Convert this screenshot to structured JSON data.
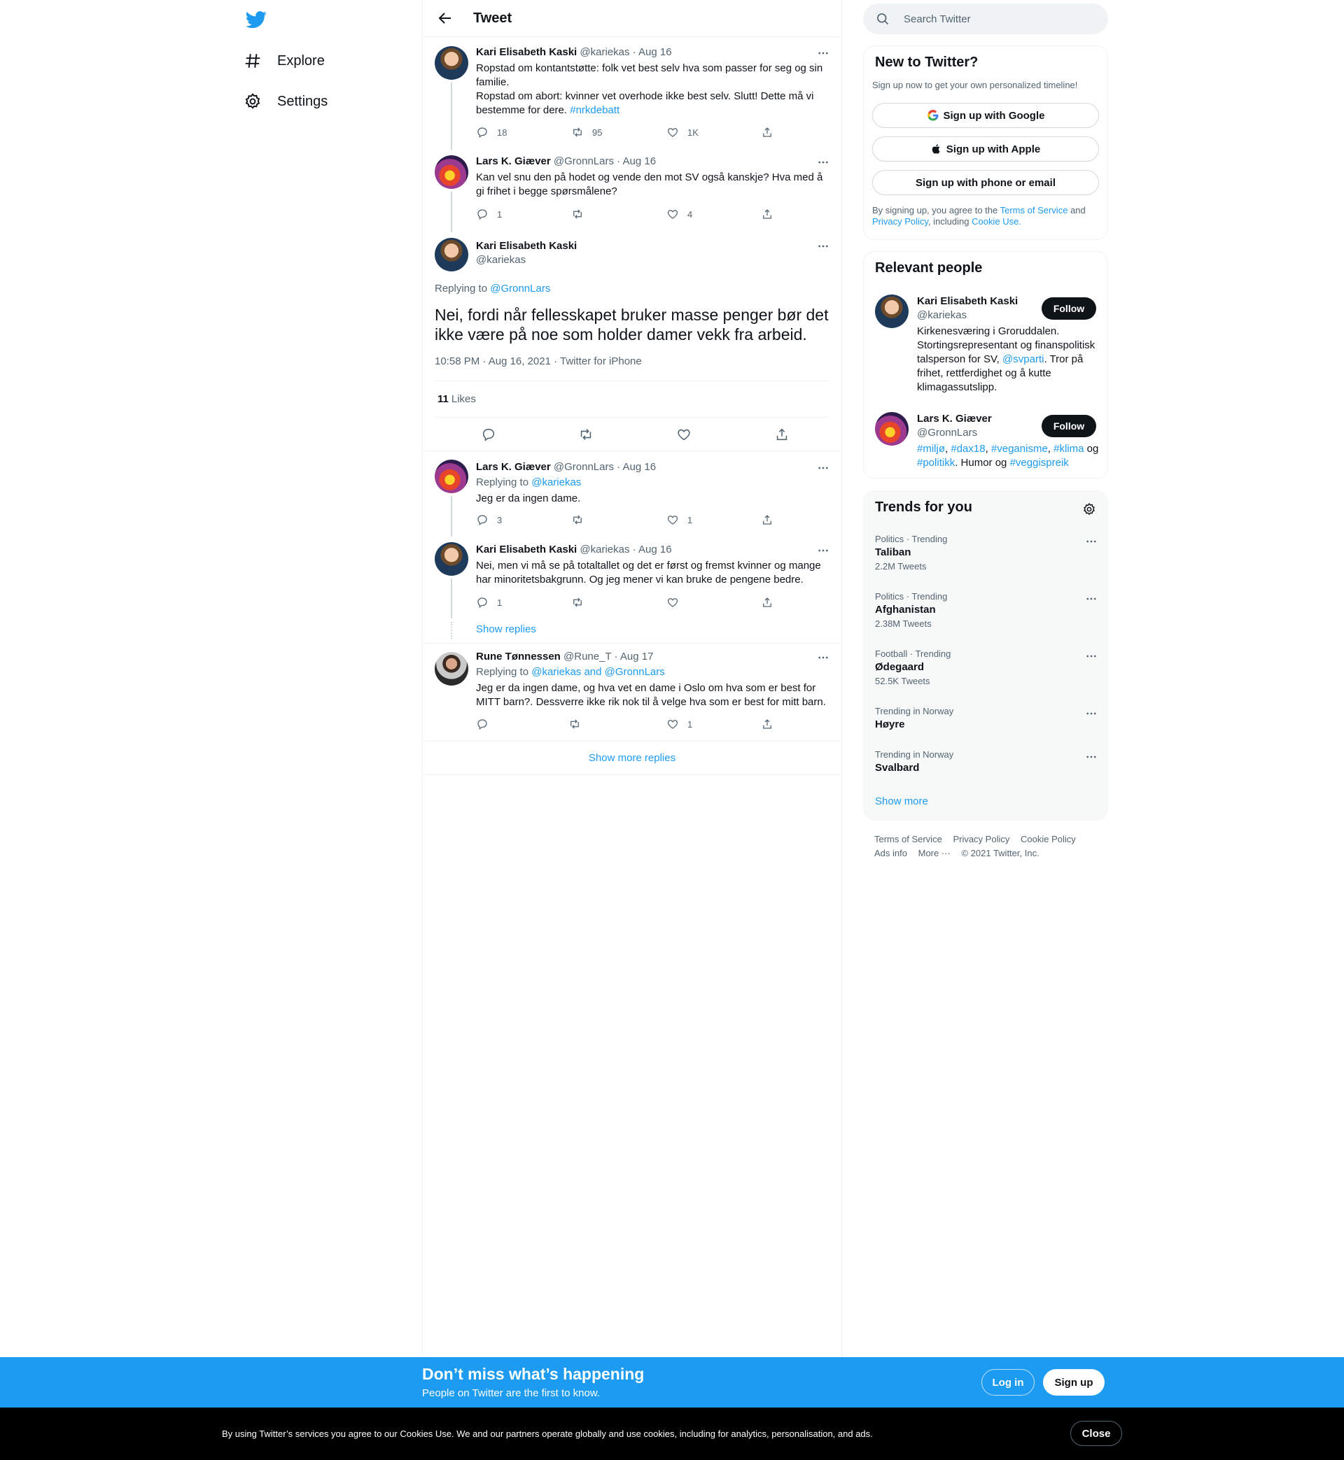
{
  "nav": {
    "explore": "Explore",
    "settings": "Settings"
  },
  "header": {
    "title": "Tweet"
  },
  "thread": [
    {
      "name": "Kari Elisabeth Kaski",
      "handle": "@kariekas",
      "date": "· Aug 16",
      "text_line1": "Ropstad om kontantstøtte: folk vet best selv hva som passer for seg og sin familie.",
      "text_line2": "Ropstad om abort: kvinner vet overhode ikke best selv. Slutt! Dette må vi bestemme for dere.",
      "hashtag": "#nrkdebatt",
      "replies": "18",
      "retweets": "95",
      "likes": "1K"
    },
    {
      "name": "Lars K. Giæver",
      "handle": "@GronnLars",
      "date": "· Aug 16",
      "text": "Kan vel snu den på hodet og vende den mot SV også kanskje? Hva med å gi frihet i begge spørsmålene?",
      "replies": "1",
      "retweets": "",
      "likes": "4"
    }
  ],
  "main_tweet": {
    "name": "Kari Elisabeth Kaski",
    "handle": "@kariekas",
    "replying_label": "Replying to",
    "replying_to": "@GronnLars",
    "text": "Nei, fordi når fellesskapet bruker masse penger bør det ikke være på noe som holder damer vekk fra arbeid.",
    "meta": "10:58 PM · Aug 16, 2021 · Twitter for iPhone",
    "likes_count": "11",
    "likes_label": "Likes"
  },
  "replies": [
    {
      "name": "Lars K. Giæver",
      "handle": "@GronnLars",
      "date": "· Aug 16",
      "replying_label": "Replying to",
      "replying_to": "@kariekas",
      "text": "Jeg er da ingen dame.",
      "replies": "3",
      "likes": "1"
    },
    {
      "name": "Kari Elisabeth Kaski",
      "handle": "@kariekas",
      "date": "· Aug 16",
      "text": "Nei, men vi må se på totaltallet og det er først og fremst kvinner og mange har minoritetsbakgrunn. Og jeg mener vi kan bruke de pengene bedre.",
      "replies": "1",
      "likes": "",
      "show_replies": "Show replies"
    },
    {
      "name": "Rune Tønnessen",
      "handle": "@Rune_T",
      "date": "· Aug 17",
      "replying_label": "Replying to",
      "replying_to": "@kariekas and @GronnLars",
      "text": "Jeg er da ingen dame, og hva vet en dame i Oslo om hva som er best for MITT barn?. Dessverre ikke rik nok til å velge hva som er best for mitt barn.",
      "replies": "",
      "likes": "1"
    }
  ],
  "show_more_replies": "Show more replies",
  "search": {
    "placeholder": "Search Twitter"
  },
  "new_to_twitter": {
    "title": "New to Twitter?",
    "subtitle": "Sign up now to get your own personalized timeline!",
    "google": "Sign up with Google",
    "apple": "Sign up with Apple",
    "phone": "Sign up with phone or email",
    "legal_1": "By signing up, you agree to the",
    "terms": "Terms of Service",
    "legal_2": "and",
    "privacy": "Privacy Policy",
    "legal_3": ", including",
    "cookie": "Cookie Use."
  },
  "relevant_people": {
    "title": "Relevant people",
    "follow_label": "Follow",
    "people": [
      {
        "name": "Kari Elisabeth Kaski",
        "handle": "@kariekas",
        "bio_1": "Kirkenesværing i Groruddalen. Stortingsrepresentant og finanspolitisk talsperson for SV,",
        "bio_link": "@svparti",
        "bio_2": ". Tror på frihet, rettferdighet og å kutte klimagassutslipp."
      },
      {
        "name": "Lars K. Giæver",
        "handle": "@GronnLars",
        "tag1": "#miljø",
        "tag2": "#dax18",
        "tag3": "#veganisme",
        "tag4": "#klima",
        "og1": "og",
        "tag5": "#politikk",
        "humor": ". Humor og",
        "tag6": "#veggispreik"
      }
    ]
  },
  "trends": {
    "title": "Trends for you",
    "items": [
      {
        "context": "Politics · Trending",
        "name": "Taliban",
        "count": "2.2M Tweets"
      },
      {
        "context": "Politics · Trending",
        "name": "Afghanistan",
        "count": "2.38M Tweets"
      },
      {
        "context": "Football · Trending",
        "name": "Ødegaard",
        "count": "52.5K Tweets"
      },
      {
        "context": "Trending in Norway",
        "name": "Høyre",
        "count": ""
      },
      {
        "context": "Trending in Norway",
        "name": "Svalbard",
        "count": ""
      }
    ],
    "show_more": "Show more"
  },
  "footer": {
    "terms": "Terms of Service",
    "privacy": "Privacy Policy",
    "cookie": "Cookie Policy",
    "ads": "Ads info",
    "more": "More ···",
    "copyright": "© 2021 Twitter, Inc."
  },
  "signup_bar": {
    "title": "Don’t miss what’s happening",
    "subtitle": "People on Twitter are the first to know.",
    "login": "Log in",
    "signup": "Sign up"
  },
  "cookie_bar": {
    "text": "By using Twitter’s services you agree to our Cookies Use. We and our partners operate globally and use cookies, including for analytics, personalisation, and ads.",
    "close": "Close"
  },
  "colors": {
    "accent": "#1d9bf0",
    "text": "#0f1419",
    "muted": "#536471",
    "border": "#eff3f4"
  }
}
